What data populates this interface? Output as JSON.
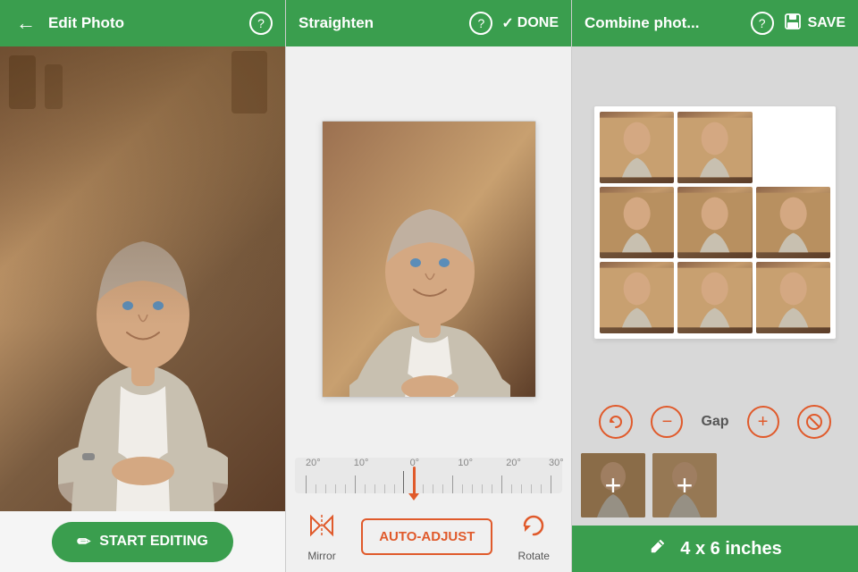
{
  "left_panel": {
    "back_label": "←",
    "title": "Edit Photo",
    "help_icon": "?",
    "start_editing_label": "START EDITING",
    "pencil_icon": "✏"
  },
  "mid_panel": {
    "title": "Straighten",
    "help_icon": "?",
    "done_check": "✓",
    "done_label": "DONE",
    "ruler": {
      "labels": [
        "20°",
        "10°",
        "0°",
        "10°",
        "20°",
        "30°"
      ]
    },
    "tools": {
      "mirror_label": "Mirror",
      "auto_adjust_label": "AUTO-ADJUST",
      "rotate_label": "Rotate"
    }
  },
  "right_panel": {
    "title": "Combine phot...",
    "help_icon": "?",
    "save_icon": "💾",
    "save_label": "SAVE",
    "gap_label": "Gap",
    "size_label": "4 x 6 inches",
    "undo_icon": "↺",
    "minus_icon": "−",
    "plus_icon": "+",
    "no_rotate_icon": "⊘",
    "edit_icon": "✏"
  },
  "colors": {
    "green": "#3a9e4e",
    "orange": "#e05a2b",
    "light_gray": "#d8d8d8",
    "mid_gray": "#f0f0f0"
  }
}
